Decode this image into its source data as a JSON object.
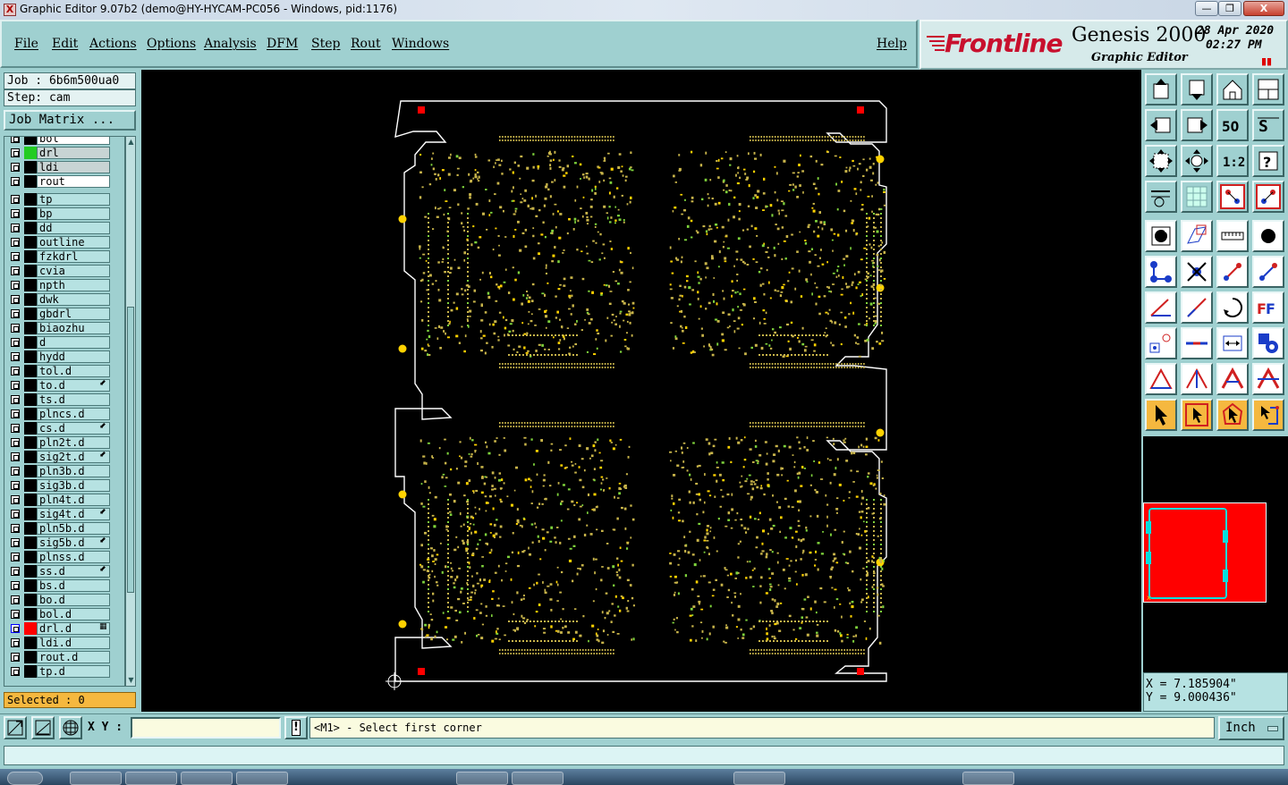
{
  "window": {
    "title": "Graphic Editor 9.07b2 (demo@HY-HYCAM-PC056 - Windows, pid:1176)",
    "app_icon": "X",
    "min_label": "—",
    "max_label": "❐",
    "close_label": "X"
  },
  "menu": {
    "items": [
      "File",
      "Edit",
      "Actions",
      "Options",
      "Analysis",
      "DFM",
      "Step",
      "Rout",
      "Windows"
    ],
    "help": "Help"
  },
  "brand": {
    "logo": "Frontline",
    "product": "Genesis 2000",
    "subtitle": "Graphic Editor",
    "date": "28 Apr 2020",
    "time": "02:27 PM",
    "pause": "▮▮"
  },
  "job": {
    "job_label": "Job : 6b6m500ua0",
    "step_label": "Step: cam",
    "matrix_button": "Job Matrix ..."
  },
  "layers": [
    {
      "name": "bol",
      "swatch": "#000000",
      "style": "white"
    },
    {
      "name": "drl",
      "swatch": "#22cc22",
      "style": "grey"
    },
    {
      "name": "ldi",
      "swatch": "#000000",
      "style": "grey"
    },
    {
      "name": "rout",
      "swatch": "#000000",
      "style": "white"
    },
    {
      "name": "tp",
      "swatch": "#000000",
      "style": ""
    },
    {
      "name": "bp",
      "swatch": "#000000",
      "style": ""
    },
    {
      "name": "dd",
      "swatch": "#000000",
      "style": ""
    },
    {
      "name": "outline",
      "swatch": "#000000",
      "style": ""
    },
    {
      "name": "fzkdrl",
      "swatch": "#000000",
      "style": ""
    },
    {
      "name": "cvia",
      "swatch": "#000000",
      "style": ""
    },
    {
      "name": "npth",
      "swatch": "#000000",
      "style": ""
    },
    {
      "name": "dwk",
      "swatch": "#000000",
      "style": ""
    },
    {
      "name": "gbdrl",
      "swatch": "#000000",
      "style": ""
    },
    {
      "name": "biaozhu",
      "swatch": "#000000",
      "style": ""
    },
    {
      "name": "d",
      "swatch": "#000000",
      "style": ""
    },
    {
      "name": "hydd",
      "swatch": "#000000",
      "style": ""
    },
    {
      "name": "tol.d",
      "swatch": "#000000",
      "style": ""
    },
    {
      "name": "to.d",
      "swatch": "#000000",
      "style": "",
      "aff": "⬋"
    },
    {
      "name": "ts.d",
      "swatch": "#000000",
      "style": ""
    },
    {
      "name": "plncs.d",
      "swatch": "#000000",
      "style": ""
    },
    {
      "name": "cs.d",
      "swatch": "#000000",
      "style": "",
      "aff": "⬋"
    },
    {
      "name": "pln2t.d",
      "swatch": "#000000",
      "style": ""
    },
    {
      "name": "sig2t.d",
      "swatch": "#000000",
      "style": "",
      "aff": "⬋"
    },
    {
      "name": "pln3b.d",
      "swatch": "#000000",
      "style": ""
    },
    {
      "name": "sig3b.d",
      "swatch": "#000000",
      "style": ""
    },
    {
      "name": "pln4t.d",
      "swatch": "#000000",
      "style": ""
    },
    {
      "name": "sig4t.d",
      "swatch": "#000000",
      "style": "",
      "aff": "⬋"
    },
    {
      "name": "pln5b.d",
      "swatch": "#000000",
      "style": ""
    },
    {
      "name": "sig5b.d",
      "swatch": "#000000",
      "style": "",
      "aff": "⬋"
    },
    {
      "name": "plnss.d",
      "swatch": "#000000",
      "style": ""
    },
    {
      "name": "ss.d",
      "swatch": "#000000",
      "style": "",
      "aff": "⬋"
    },
    {
      "name": "bs.d",
      "swatch": "#000000",
      "style": ""
    },
    {
      "name": "bo.d",
      "swatch": "#000000",
      "style": ""
    },
    {
      "name": "bol.d",
      "swatch": "#000000",
      "style": ""
    },
    {
      "name": "drl.d",
      "swatch": "#ff0000",
      "style": "",
      "aff": "▦",
      "active": true
    },
    {
      "name": "ldi.d",
      "swatch": "#000000",
      "style": ""
    },
    {
      "name": "rout.d",
      "swatch": "#000000",
      "style": ""
    },
    {
      "name": "tp.d",
      "swatch": "#000000",
      "style": ""
    }
  ],
  "selected": "Selected : 0",
  "tools": [
    "move-layer-icon",
    "copy-layer-icon",
    "home-icon",
    "window-split-icon",
    "pan-left-icon",
    "pan-right-icon",
    "undo-zoom-icon",
    "redo-zoom-icon",
    "zoom-fit-icon",
    "zoom-center-icon",
    "scale-1-2-icon",
    "help-icon",
    "snap-grid-icon",
    "grid-icon",
    "layer-compare-icon",
    "layer-diff-icon",
    "pad-icon",
    "shape-icon",
    "ruler-icon",
    "dot-icon",
    "net-icon",
    "cross-icon",
    "line-icon",
    "arrow-line-icon",
    "angle-icon",
    "slash-icon",
    "arc-icon",
    "feature-icon",
    "add-pad-icon",
    "split-line-icon",
    "measure-icon",
    "pattern-icon",
    "triangle-icon",
    "triangle-up-icon",
    "triangle-frame-icon",
    "triangle-cut-icon",
    "select-arrow-icon",
    "select-box-icon",
    "select-poly-icon",
    "select-net-icon"
  ],
  "coords": {
    "x": "X = 7.185904\"",
    "y": "Y = 9.000436\""
  },
  "cmd": {
    "xy_label": "X Y :",
    "xy_value": "",
    "alert_icon": "!",
    "prompt": "<M1> - Select first corner",
    "unit": "Inch"
  },
  "message": "",
  "colors": {
    "panel": "#9fd0d0",
    "board_outline": "#ffffff",
    "drill_red": "#ff0000",
    "pad_yellow": "#ffd200",
    "feature_dim": "#c8b44a",
    "feature_green": "#7ed23c",
    "selected_bar": "#f5b83f"
  }
}
